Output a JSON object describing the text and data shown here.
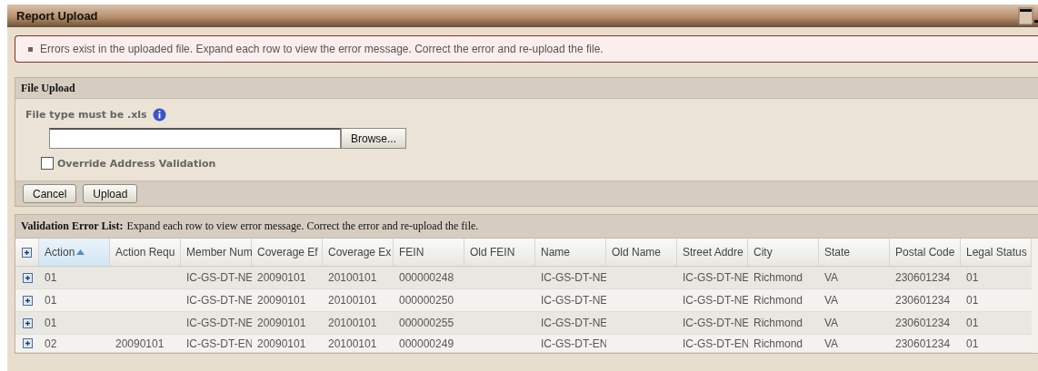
{
  "window": {
    "title": "Report Upload"
  },
  "error_message": "Errors exist in the uploaded file. Expand each row to view the error message. Correct the error and re-upload the file.",
  "file_upload": {
    "title": "File Upload",
    "hint": "File type must be .xls",
    "browse_button": "Browse...",
    "override": {
      "label": "Override Address Validation",
      "checked": false
    },
    "buttons": [
      "Cancel",
      "Upload"
    ]
  },
  "validation": {
    "title": "Validation Error List:",
    "description": "Expand each row to view error message. Correct the error and re-upload the file.",
    "columns": [
      {
        "label": "Action",
        "sorted": true
      },
      {
        "label": "Action Requ",
        "sorted": false
      },
      {
        "label": "Member Num",
        "sorted": false
      },
      {
        "label": "Coverage Ef",
        "sorted": false
      },
      {
        "label": "Coverage Ex",
        "sorted": false
      },
      {
        "label": "FEIN",
        "sorted": false
      },
      {
        "label": "Old FEIN",
        "sorted": false
      },
      {
        "label": "Name",
        "sorted": false
      },
      {
        "label": "Old Name",
        "sorted": false
      },
      {
        "label": "Street Addre",
        "sorted": false
      },
      {
        "label": "City",
        "sorted": false
      },
      {
        "label": "State",
        "sorted": false
      },
      {
        "label": "Postal Code",
        "sorted": false
      },
      {
        "label": "Legal Status",
        "sorted": false
      }
    ],
    "rows": [
      {
        "expanded": false,
        "cells": [
          "01",
          "",
          "IC-GS-DT-NE",
          "20090101",
          "20100101",
          "000000248",
          "",
          "IC-GS-DT-NE",
          "",
          "IC-GS-DT-NE",
          "Richmond",
          "VA",
          "230601234",
          "01"
        ]
      },
      {
        "expanded": false,
        "cells": [
          "01",
          "",
          "IC-GS-DT-NE",
          "20090101",
          "20100101",
          "000000250",
          "",
          "IC-GS-DT-NE",
          "",
          "IC-GS-DT-NE",
          "Richmond",
          "VA",
          "230601234",
          "01"
        ]
      },
      {
        "expanded": false,
        "cells": [
          "01",
          "",
          "IC-GS-DT-NE",
          "20090101",
          "20100101",
          "000000255",
          "",
          "IC-GS-DT-NE",
          "",
          "IC-GS-DT-NE",
          "Richmond",
          "VA",
          "230601234",
          "01"
        ]
      },
      {
        "expanded": false,
        "cells": [
          "02",
          "20090101",
          "IC-GS-DT-EN",
          "20090101",
          "20100101",
          "000000249",
          "",
          "IC-GS-DT-EN",
          "",
          "IC-GS-DT-EN",
          "Richmond",
          "VA",
          "230601234",
          "01"
        ]
      }
    ]
  }
}
